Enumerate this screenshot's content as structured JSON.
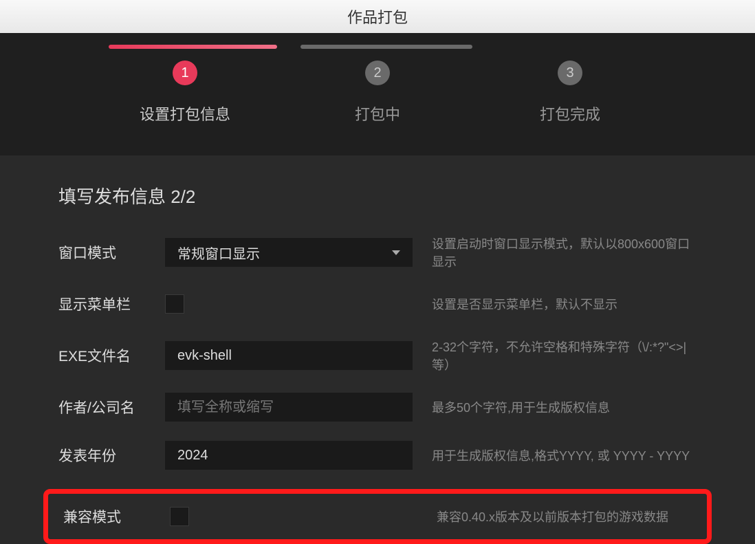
{
  "titlebar": {
    "title": "作品打包"
  },
  "stepper": {
    "steps": [
      {
        "number": "1",
        "label": "设置打包信息",
        "active": true
      },
      {
        "number": "2",
        "label": "打包中",
        "active": false
      },
      {
        "number": "3",
        "label": "打包完成",
        "active": false
      }
    ]
  },
  "section": {
    "title": "填写发布信息 2/2"
  },
  "fields": {
    "window_mode": {
      "label": "窗口模式",
      "value": "常规窗口显示",
      "hint": "设置启动时窗口显示模式，默认以800x600窗口显示"
    },
    "show_menubar": {
      "label": "显示菜单栏",
      "hint": "设置是否显示菜单栏，默认不显示"
    },
    "exe_filename": {
      "label": "EXE文件名",
      "value": "evk-shell",
      "hint": "2-32个字符，不允许空格和特殊字符（\\/:*?\"<>|等）"
    },
    "author": {
      "label": "作者/公司名",
      "placeholder": "填写全称或缩写",
      "hint": "最多50个字符,用于生成版权信息"
    },
    "year": {
      "label": "发表年份",
      "value": "2024",
      "hint": "用于生成版权信息,格式YYYY, 或 YYYY - YYYY"
    },
    "compat_mode": {
      "label": "兼容模式",
      "hint": "兼容0.40.x版本及以前版本打包的游戏数据"
    }
  }
}
